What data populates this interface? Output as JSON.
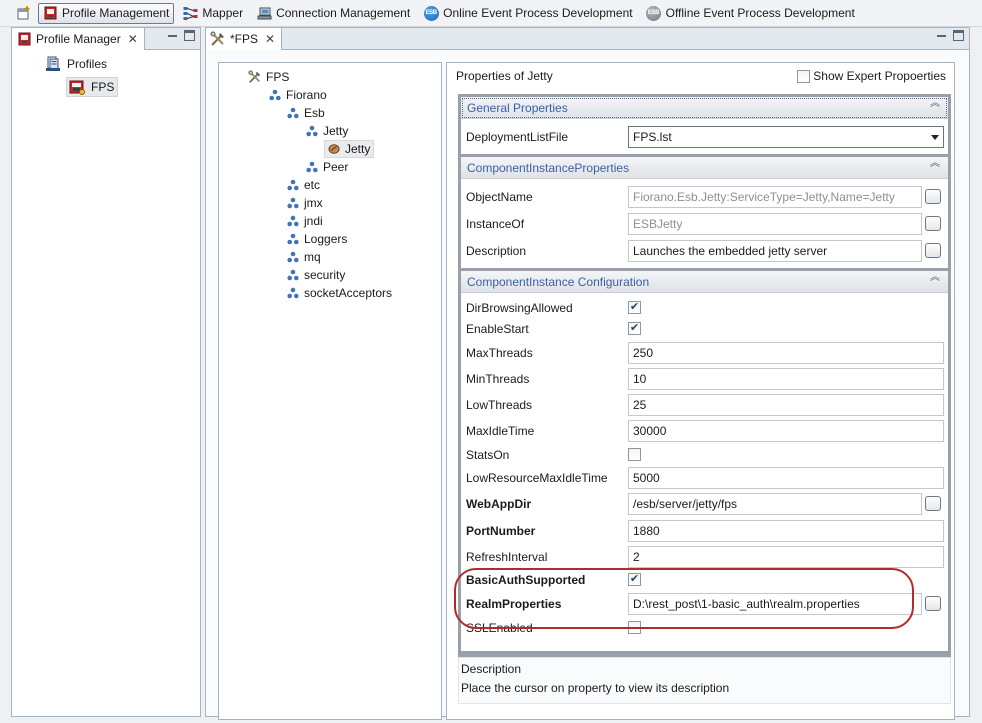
{
  "toolbar": {
    "perspectives": [
      {
        "label": "Profile Management",
        "icon": "profile-management-icon",
        "active": true
      },
      {
        "label": "Mapper",
        "icon": "mapper-icon",
        "active": false
      },
      {
        "label": "Connection Management",
        "icon": "connection-icon",
        "active": false
      },
      {
        "label": "Online Event Process Development",
        "icon": "esb-online-icon",
        "badge": "ESB",
        "active": false
      },
      {
        "label": "Offline Event Process Development",
        "icon": "esb-offline-icon",
        "badge": "ESB",
        "active": false
      }
    ]
  },
  "profile_manager": {
    "tab_label": "Profile Manager",
    "tree": [
      {
        "label": "Profiles",
        "icon": "profiles-folder-icon"
      },
      {
        "label": "FPS",
        "icon": "fps-profile-icon",
        "selected": true
      }
    ]
  },
  "editor": {
    "tab_label": "*FPS",
    "tree": [
      {
        "label": "FPS",
        "icon": "tools-icon"
      },
      {
        "label": "Fiorano",
        "icon": "node-icon"
      },
      {
        "label": "Esb",
        "icon": "node-icon"
      },
      {
        "label": "Jetty",
        "icon": "node-icon"
      },
      {
        "label": "Jetty",
        "icon": "component-icon",
        "selected": true
      },
      {
        "label": "Peer",
        "icon": "node-icon"
      },
      {
        "label": "etc",
        "icon": "node-icon"
      },
      {
        "label": "jmx",
        "icon": "node-icon"
      },
      {
        "label": "jndi",
        "icon": "node-icon"
      },
      {
        "label": "Loggers",
        "icon": "node-icon"
      },
      {
        "label": "mq",
        "icon": "node-icon"
      },
      {
        "label": "security",
        "icon": "node-icon"
      },
      {
        "label": "socketAcceptors",
        "icon": "node-icon"
      }
    ],
    "properties": {
      "title": "Properties of Jetty",
      "show_expert_label": "Show Expert Propoerties",
      "show_expert_checked": false,
      "general": {
        "header": "General Properties",
        "deployment_label": "DeploymentListFile",
        "deployment_value": "FPS.lst"
      },
      "instance": {
        "header": "ComponentInstanceProperties",
        "object_name_label": "ObjectName",
        "object_name_value": "Fiorano.Esb.Jetty:ServiceType=Jetty,Name=Jetty",
        "instance_of_label": "InstanceOf",
        "instance_of_value": "ESBJetty",
        "description_label": "Description",
        "description_value": "Launches the embedded jetty server"
      },
      "config": {
        "header": "ComponentInstance Configuration",
        "dir_browsing_label": "DirBrowsingAllowed",
        "dir_browsing_checked": true,
        "enable_start_label": "EnableStart",
        "enable_start_checked": true,
        "max_threads_label": "MaxThreads",
        "max_threads_value": "250",
        "min_threads_label": "MinThreads",
        "min_threads_value": "10",
        "low_threads_label": "LowThreads",
        "low_threads_value": "25",
        "max_idle_label": "MaxIdleTime",
        "max_idle_value": "30000",
        "stats_on_label": "StatsOn",
        "stats_on_checked": false,
        "low_resource_label": "LowResourceMaxIdleTime",
        "low_resource_value": "5000",
        "webapp_dir_label": "WebAppDir",
        "webapp_dir_value": "/esb/server/jetty/fps",
        "port_label": "PortNumber",
        "port_value": "1880",
        "refresh_label": "RefreshInterval",
        "refresh_value": "2",
        "basic_auth_label": "BasicAuthSupported",
        "basic_auth_checked": true,
        "realm_label": "RealmProperties",
        "realm_value": "D:\\rest_post\\1-basic_auth\\realm.properties",
        "ssl_label": "SSLEnabled",
        "ssl_checked": false
      }
    },
    "description_panel": {
      "title": "Description",
      "text": "Place the cursor on property to view its description"
    }
  },
  "colors": {
    "section_header_text": "#3b5fa6",
    "highlight_oval": "#b22a2a"
  }
}
